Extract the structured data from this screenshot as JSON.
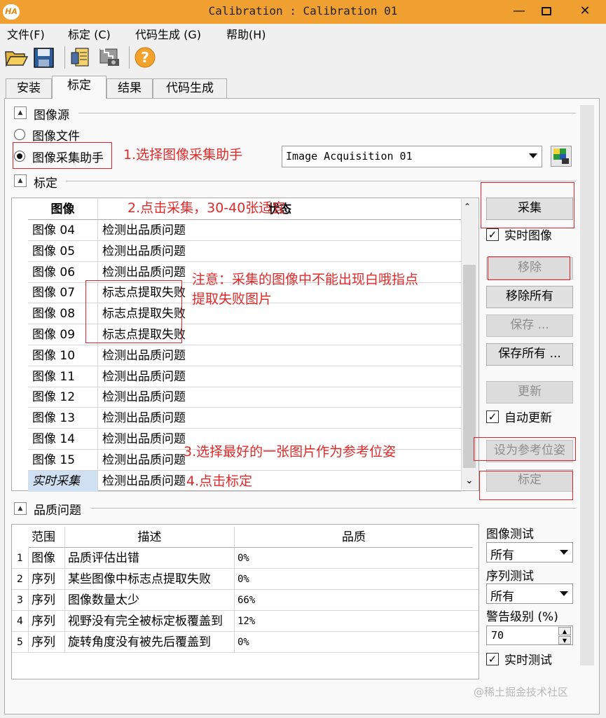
{
  "window": {
    "title": "Calibration : Calibration 01",
    "app_icon": "HA",
    "controls": [
      "—",
      "",
      "✕"
    ]
  },
  "menu": [
    "文件(F)",
    "标定 (C)",
    "代码生成 (G)",
    "帮助(H)"
  ],
  "toolbar_icons": [
    "open-folder-icon",
    "save-icon",
    "code-file-icon",
    "camera-grid-icon",
    "help-icon"
  ],
  "tabs": [
    "安装",
    "标定",
    "结果",
    "代码生成"
  ],
  "active_tab": 1,
  "image_source": {
    "title": "图像源",
    "toggle": "▲",
    "option_file": "图像文件",
    "option_assistant": "图像采集助手",
    "selected": "option_assistant",
    "assistant_value": "Image Acquisition 01"
  },
  "calibration": {
    "title": "标定",
    "toggle": "▲",
    "columns": [
      "图像",
      "状态"
    ],
    "rows": [
      {
        "image": "图像 04",
        "status": "检测出品质问题"
      },
      {
        "image": "图像 05",
        "status": "检测出品质问题"
      },
      {
        "image": "图像 06",
        "status": "检测出品质问题"
      },
      {
        "image": "图像 07",
        "status": "标志点提取失败"
      },
      {
        "image": "图像 08",
        "status": "标志点提取失败"
      },
      {
        "image": "图像 09",
        "status": "标志点提取失败"
      },
      {
        "image": "图像 10",
        "status": "检测出品质问题"
      },
      {
        "image": "图像 11",
        "status": "检测出品质问题"
      },
      {
        "image": "图像 12",
        "status": "检测出品质问题"
      },
      {
        "image": "图像 13",
        "status": "检测出品质问题"
      },
      {
        "image": "图像 14",
        "status": "检测出品质问题"
      },
      {
        "image": "图像 15",
        "status": "检测出品质问题"
      },
      {
        "image": "实时采集",
        "status": "检测出品质问题"
      }
    ],
    "buttons": {
      "capture": "采集",
      "live_image": "实时图像",
      "remove": "移除",
      "remove_all": "移除所有",
      "save": "保存 ...",
      "save_all": "保存所有 ...",
      "update": "更新",
      "auto_update": "自动更新",
      "set_reference": "设为参考位姿",
      "calibrate": "标定"
    }
  },
  "quality": {
    "title": "品质问题",
    "toggle": "▲",
    "columns": [
      "范围",
      "描述",
      "品质"
    ],
    "rows": [
      {
        "n": "1",
        "scope": "图像",
        "desc": "品质评估出错",
        "quality": "0%"
      },
      {
        "n": "2",
        "scope": "序列",
        "desc": "某些图像中标志点提取失败",
        "quality": "0%"
      },
      {
        "n": "3",
        "scope": "序列",
        "desc": "图像数量太少",
        "quality": "66%"
      },
      {
        "n": "4",
        "scope": "序列",
        "desc": "视野没有完全被标定板覆盖到",
        "quality": "12%"
      },
      {
        "n": "5",
        "scope": "序列",
        "desc": "旋转角度没有被先后覆盖到",
        "quality": "0%"
      }
    ],
    "image_test_label": "图像测试",
    "image_test_value": "所有",
    "sequence_test_label": "序列测试",
    "sequence_test_value": "所有",
    "warning_level_label": "警告级别 (%)",
    "warning_level_value": "70",
    "live_test": "实时测试"
  },
  "annotations": {
    "a1": "1.选择图像采集助手",
    "a2": "2.点击采集，30-40张适宜",
    "a_note_line1": "注意：采集的图像中不能出现白哦指点",
    "a_note_line2": "提取失败图片",
    "a3": "3.选择最好的一张图片作为参考位姿",
    "a4": "4.点击标定"
  },
  "watermark": "@稀土掘金技术社区",
  "colors": {
    "titlebar": "#f0a030",
    "annotation": "#e02a2a",
    "selected_row": "#cfe0f2"
  }
}
